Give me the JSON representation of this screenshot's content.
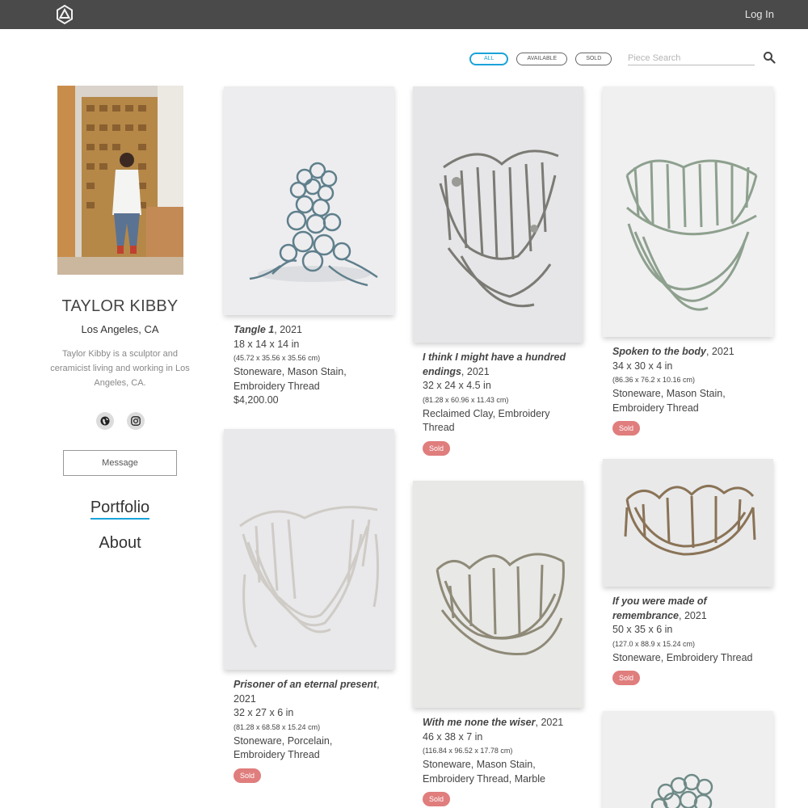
{
  "header": {
    "login_label": "Log In"
  },
  "filters": {
    "pills": [
      {
        "label": "ALL",
        "active": true
      },
      {
        "label": "AVAILABLE",
        "active": false
      },
      {
        "label": "SOLD",
        "active": false
      }
    ],
    "search_placeholder": "Piece Search"
  },
  "artist": {
    "name": "TAYLOR KIBBY",
    "location": "Los Angeles, CA",
    "bio": "Taylor Kibby is a sculptor and ceramicist living and working in Los Angeles, CA.",
    "socials": [
      "globe-icon",
      "instagram-icon"
    ],
    "message_label": "Message"
  },
  "nav": {
    "portfolio_label": "Portfolio",
    "about_label": "About"
  },
  "colors": {
    "topbar": "#4a4a4a",
    "accent": "#1aa3d9",
    "sold_badge": "#e07d7d"
  },
  "works": [
    {
      "title": "Tangle 1",
      "year": ", 2021",
      "dims_in": "18 x 14 x 14 in",
      "dims_cm": "(45.72 x 35.56 x 35.56 cm)",
      "materials": "Stoneware, Mason Stain, Embroidery Thread",
      "price": "$4,200.00",
      "status": ""
    },
    {
      "title": "I think I might have a hundred endings",
      "year": ", 2021",
      "dims_in": "32 x 24 x 4.5 in",
      "dims_cm": "(81.28 x 60.96 x 11.43 cm)",
      "materials": "Reclaimed Clay, Embroidery Thread",
      "price": "",
      "status": "Sold"
    },
    {
      "title": "Spoken to the body",
      "year": ", 2021",
      "dims_in": "34 x 30 x 4 in",
      "dims_cm": "(86.36 x 76.2 x 10.16 cm)",
      "materials": "Stoneware, Mason Stain, Embroidery Thread",
      "price": "",
      "status": "Sold"
    },
    {
      "title": "Prisoner of an eternal present",
      "year": ", 2021",
      "dims_in": "32 x 27 x 6 in",
      "dims_cm": "(81.28 x 68.58 x 15.24 cm)",
      "materials": "Stoneware, Porcelain, Embroidery Thread",
      "price": "",
      "status": "Sold"
    },
    {
      "title": "With me none the wiser",
      "year": ", 2021",
      "dims_in": "46 x 38 x 7 in",
      "dims_cm": "(116.84 x 96.52 x 17.78 cm)",
      "materials": "Stoneware, Mason Stain, Embroidery Thread, Marble",
      "price": "",
      "status": "Sold"
    },
    {
      "title": "If you were made of remembrance",
      "year": ", 2021",
      "dims_in": "50 x 35 x 6 in",
      "dims_cm": "(127.0 x 88.9 x 15.24 cm)",
      "materials": "Stoneware, Embroidery Thread",
      "price": "",
      "status": "Sold"
    }
  ]
}
